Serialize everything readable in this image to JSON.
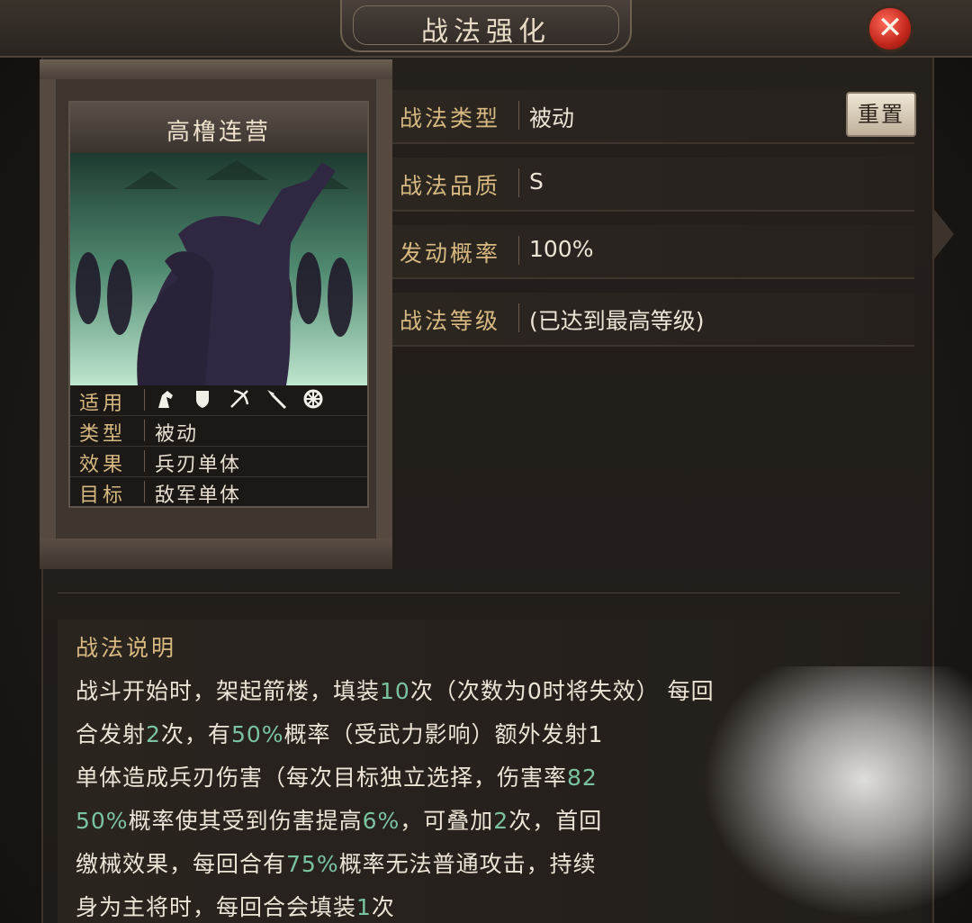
{
  "window": {
    "title": "战法强化",
    "close_icon": "close-icon"
  },
  "card": {
    "name": "高橹连营",
    "rows": [
      {
        "key": "适用",
        "value": ""
      },
      {
        "key": "类型",
        "value": "被动"
      },
      {
        "key": "效果",
        "value": "兵刃单体"
      },
      {
        "key": "目标",
        "value": "敌军单体"
      }
    ],
    "troop_icons": [
      "cavalry-icon",
      "shield-icon",
      "bow-icon",
      "spear-icon",
      "siege-wheel-icon"
    ]
  },
  "properties": [
    {
      "key": "战法类型",
      "value": "被动"
    },
    {
      "key": "战法品质",
      "value": "S"
    },
    {
      "key": "发动概率",
      "value": "100%"
    },
    {
      "key": "战法等级",
      "value": "(已达到最高等级)"
    }
  ],
  "reset_button": "重置",
  "description": {
    "title": "战法说明",
    "lines": [
      [
        {
          "t": "战斗开始时，架起箭楼，填装"
        },
        {
          "t": "10",
          "h": true
        },
        {
          "t": "次（次数为0时将失效）   每回"
        }
      ],
      [
        {
          "t": "合发射"
        },
        {
          "t": "2",
          "h": true
        },
        {
          "t": "次，有"
        },
        {
          "t": "50%",
          "h": true
        },
        {
          "t": "概率（受武力影响）额外发射1"
        }
      ],
      [
        {
          "t": "单体造成兵刃伤害（每次目标独立选择，伤害率"
        },
        {
          "t": "82",
          "h": true
        }
      ],
      [
        {
          "t": "50%",
          "h": true
        },
        {
          "t": "概率使其受到伤害提高"
        },
        {
          "t": "6%",
          "h": true
        },
        {
          "t": "，可叠加"
        },
        {
          "t": "2",
          "h": true
        },
        {
          "t": "次，首回"
        }
      ],
      [
        {
          "t": "缴械效果，每回合有"
        },
        {
          "t": "75%",
          "h": true
        },
        {
          "t": "概率无法普通攻击，持续"
        }
      ],
      [
        {
          "t": "身为主将时，每回合会填装"
        },
        {
          "t": "1",
          "h": true
        },
        {
          "t": "次"
        }
      ]
    ]
  },
  "colors": {
    "accent_gold": "#d8b980",
    "highlight_green": "#7ac3a0",
    "close_red": "#c1261a"
  }
}
